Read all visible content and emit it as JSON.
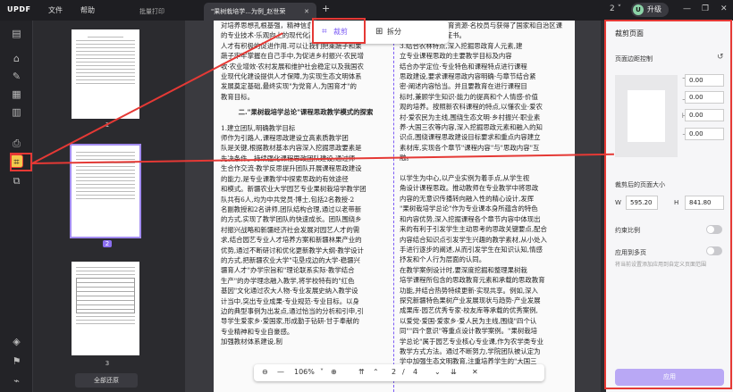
{
  "app": {
    "logo": "UPDF",
    "menu_file": "文件",
    "menu_help": "帮助",
    "tab_batch": "批量打印",
    "tab_doc": "\"果树栽培学...为例_赵世荣",
    "tab_add": "+",
    "page_count_badge": "2",
    "upgrade_label": "升级",
    "upgrade_avatar": "U"
  },
  "leftbar": {
    "icons": [
      "sidebar-icon",
      "stamp-icon",
      "edit-icon",
      "form-icon",
      "organize-icon",
      "ocr-icon",
      "crop-icon",
      "layers-icon",
      "more-icon"
    ]
  },
  "thumbnails": {
    "pages": [
      {
        "number": "1",
        "selected": false
      },
      {
        "number": "2",
        "selected": true
      },
      {
        "number": "3",
        "selected": false
      }
    ],
    "restore_all": "全部还原"
  },
  "modes": {
    "crop": "裁剪",
    "split": "拆分"
  },
  "document": {
    "left_col": [
      "对培养思想孔根基强，精神信息，创新思想，乡村",
      "的专业技术·乐观向上的现代化高素质综合型园艺",
      "人才有积极的促进作用.可以让我们把莱蔬子和果",
      "蔬子牢牢掌握在自己手中,为促进乡村振兴·农民增",
      "收·农业增效·农村发展和维护社会稳定以及我国农",
      "业现代化建设提供人才保障,为实现生态文明体系",
      "发展奠定基础,最终实现\"为党育人,为国育才\"的",
      "教育目标。"
    ],
    "left_heading": "二.\"果树栽培学总论\"课程思政教学模式的探索",
    "left_col2": [
      "1.建立团队,明确教学目标",
      "师作为引路人,课程思政建设立高素质教学团",
      "队是关键,根据教材基本内容深入挖掘思政要素是",
      "先决条件。持续强化课程思政团队建设,通过师",
      "生合作交流·教学反思提升团队开展课程思政建设",
      "的能力,是专业课教学中探索思政的有效途径",
      "和模式。新疆农业大学园艺专业果树栽培学教学团",
      "队共有6人,均为中共党员·博士,包括2名教授·2",
      "名副教授和2名讲师,团队结构合理,通过以老带新",
      "的方式,实现了教学团队的快速成长。团队围绕乡",
      "村振兴战略和新疆经济社会发展对园艺人才的需",
      "求,结合园艺专业人才培养方案和新疆林果产业的",
      "优势,通过不断研讨和优化更新教学大纲·教学设计",
      "的方式,把新疆农业大学\"屯垦戍边的大学·稳疆兴",
      "疆育人才\"办学宗旨和\"理论联系实际·教学结合",
      "生产\"的办学理念融入教学,将学校特有的\"红色",
      "基因\"文化通过农大人物·专业发展史纳入教学设",
      "计当中,突出专业成果·专业规范·专业目标。以身",
      "边的典型事例为出发点,通过恰当的分析和引申,引",
      "导学生爱家乡·爱国家,形成勤于钻研·甘于奉献的",
      "专业精神和专业自豪感。",
      "加强教材体系建设,制"
    ],
    "right_col": [
      "为学生教学中,教育资源·名校员与获得了国家和自治区课",
      "程思政培训合格证书。",
      "3.结合农林特点,深入挖掘思政育人元素,建",
      "立专业课程思政的主要教学目标及内容",
      "结合办学定位·专业特色和课程特点进行课程",
      "思政建设,要求课程思政内容明确·与章节结合紧",
      "密·阐述内容恰当。并且要教育在进行课程目",
      "标时,兼顾学生知识·能力的提高和个人情感·价值",
      "观的培养。按照新农科课程的特点,以懂农业·爱农",
      "村·爱农民为主线,围绕生态文明·乡村振兴·职业素",
      "养·大国三农等内容,深入挖掘思政元素和融入的知",
      "识点,围绕课程思政建设目标要求和重点内容建立",
      "素材库,实现各个章节\"课程内容\"与\"思政内容\"互",
      "融。",
      "",
      "以学生为中心,以产业实例为着手点,从学生视",
      "角设计课程思政。推动教师在专业教学中将思政",
      "内容的无意识传播转向融入性的精心设计,发挥",
      "\"果树栽培学总论\"作为专业课本身所蕴含的特色",
      "和内容优势,深入挖掘课程各个章节内容中体现出",
      "来的有利于引发学生主动思考的思政关键要点,配合",
      "内容结合知识点引发学生兴趣的教学素材,从小处入",
      "手进行逐步的阐述,从而引发学生在知识认知,情感",
      "抒发和个人行为层面的认同。",
      "在教学案例设计时,要深度挖掘和整理果树栽",
      "培学课程所包含的思政教育元素和承载的思政教育",
      "功能,并结合热势特续更新·实现共享。例如,深入",
      "探究新疆特色果树产业发展现状与趋势·产业发展",
      "成果库·园艺优秀专家·校友库等承载的优秀案例,",
      "以爱党·爱国·爱家乡·爱人民为主线,围绕\"四个认",
      "同\"\"四个意识\"等重点设计教学案例。\"果树栽培",
      "学总论\"属于园艺专业核心专业课,作为农学类专业",
      "教学方式方法。通过不断努力,学院团队被认定为",
      "学中加强生态文明教育,注重培养学生的\"大国三"
    ]
  },
  "pager": {
    "zoom": "106%",
    "current": "2",
    "sep": "/",
    "total": "4"
  },
  "panel": {
    "title": "裁剪页面",
    "margin_label": "页面边距控制",
    "margins": {
      "top": "0.00",
      "bottom": "0.00",
      "left": "0.00",
      "right": "0.00"
    },
    "size_label": "裁剪后的页面大小",
    "width_label": "W",
    "width_value": "595.20",
    "height_label": "H",
    "height_value": "841.80",
    "ratio_label": "约束比例",
    "apply_all_label": "应用到多页",
    "apply_all_sub": "将当前设置添加应用到自定义页面范围",
    "apply_button": "应用"
  },
  "colors": {
    "accent": "#7c5cf5",
    "highlight": "#e53935",
    "selected_tool": "#f2c94c"
  }
}
